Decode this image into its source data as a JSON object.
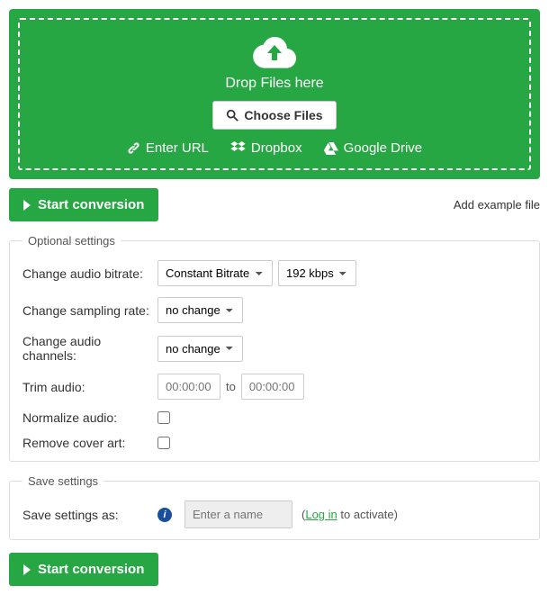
{
  "dropzone": {
    "drop_text": "Drop Files here",
    "choose_label": "Choose Files",
    "sources": {
      "url": "Enter URL",
      "dropbox": "Dropbox",
      "gdrive": "Google Drive"
    }
  },
  "buttons": {
    "start_conversion": "Start conversion",
    "add_example": "Add example file"
  },
  "optional": {
    "legend": "Optional settings",
    "bitrate_label": "Change audio bitrate:",
    "bitrate_mode": "Constant Bitrate",
    "bitrate_value": "192 kbps",
    "sampling_label": "Change sampling rate:",
    "sampling_value": "no change",
    "channels_label": "Change audio channels:",
    "channels_value": "no change",
    "trim_label": "Trim audio:",
    "trim_from": "00:00:00",
    "trim_to_label": "to",
    "trim_to": "00:00:00",
    "normalize_label": "Normalize audio:",
    "cover_label": "Remove cover art:"
  },
  "save": {
    "legend": "Save settings",
    "save_as_label": "Save settings as:",
    "placeholder": "Enter a name",
    "login_text": "Log in",
    "activate_text": " to activate)",
    "open_paren": "("
  }
}
